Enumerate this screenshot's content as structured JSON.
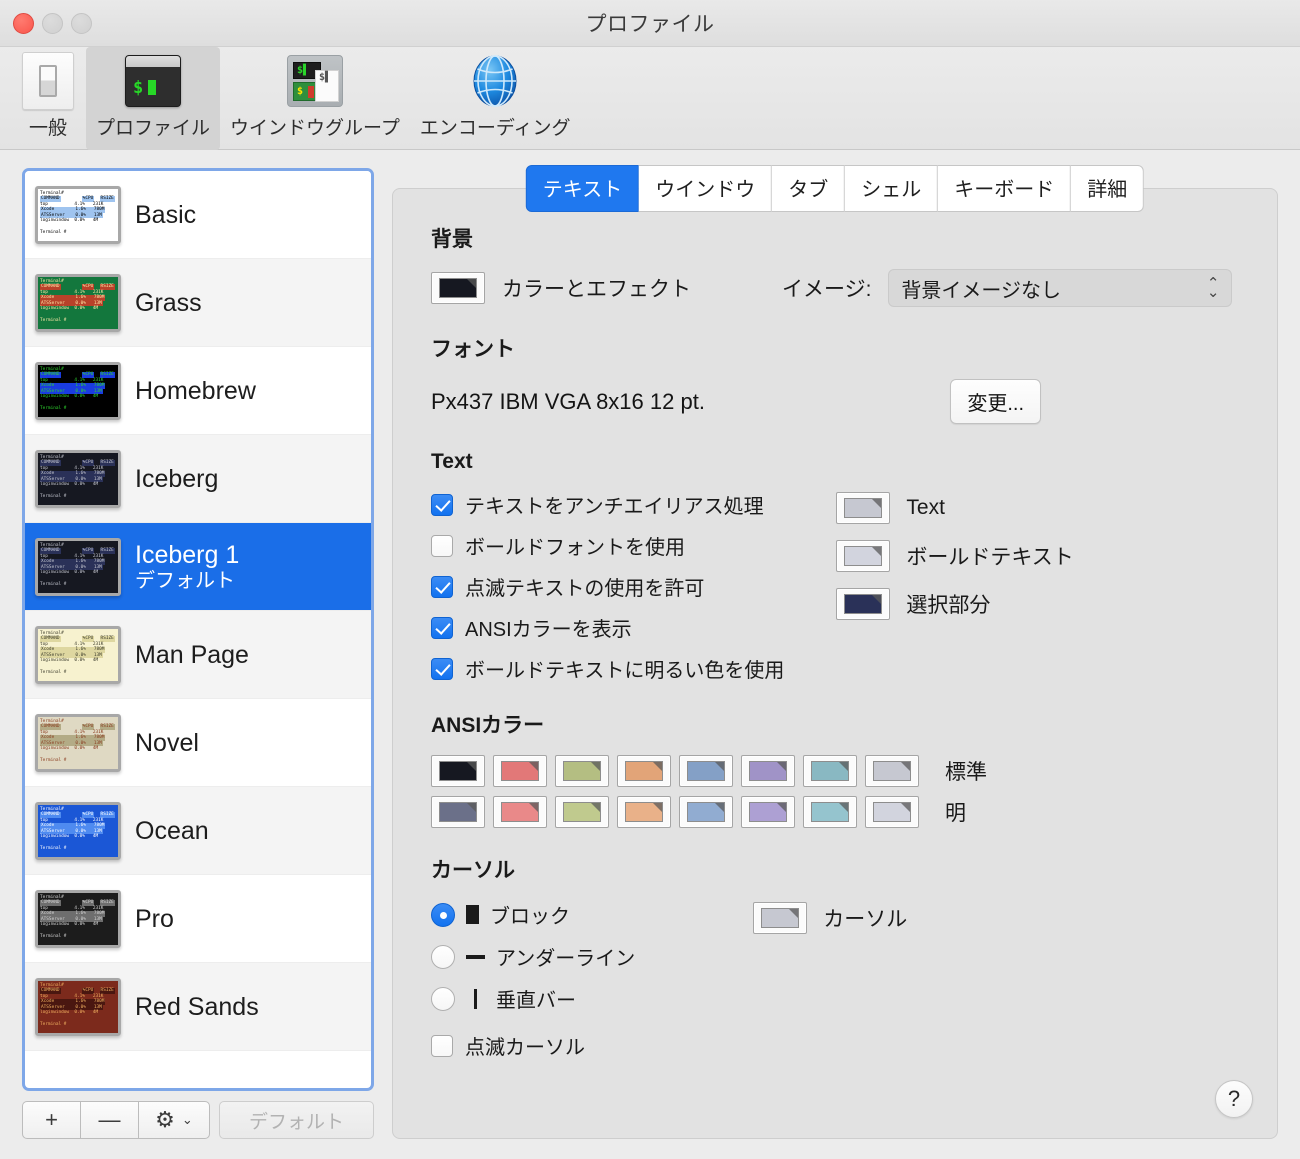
{
  "window": {
    "title": "プロファイル",
    "traffic_lights": [
      "close",
      "minimize",
      "maximize"
    ]
  },
  "toolbar": {
    "items": [
      {
        "label": "一般",
        "icon": "toggle-switch-icon",
        "active": false
      },
      {
        "label": "プロファイル",
        "icon": "terminal-icon",
        "active": true
      },
      {
        "label": "ウインドウグループ",
        "icon": "window-group-icon",
        "active": false
      },
      {
        "label": "エンコーディング",
        "icon": "globe-icon",
        "active": false
      }
    ]
  },
  "profile_list": {
    "items": [
      {
        "name": "Basic",
        "subtitle": "",
        "selected": false,
        "bg": "#ffffff",
        "fg": "#000000",
        "accent": "#9fc4ef"
      },
      {
        "name": "Grass",
        "subtitle": "",
        "selected": false,
        "bg": "#13773d",
        "fg": "#ffe9a8",
        "accent": "#b8422a"
      },
      {
        "name": "Homebrew",
        "subtitle": "",
        "selected": false,
        "bg": "#000000",
        "fg": "#2fd82f",
        "accent": "#1a3ce0"
      },
      {
        "name": "Iceberg",
        "subtitle": "",
        "selected": false,
        "bg": "#161821",
        "fg": "#c6c8d1",
        "accent": "#2a3158"
      },
      {
        "name": "Iceberg 1",
        "subtitle": "デフォルト",
        "selected": true,
        "bg": "#161821",
        "fg": "#c6c8d1",
        "accent": "#2a3158"
      },
      {
        "name": "Man Page",
        "subtitle": "",
        "selected": false,
        "bg": "#f7f2cf",
        "fg": "#3a3a2a",
        "accent": "#ded7a0"
      },
      {
        "name": "Novel",
        "subtitle": "",
        "selected": false,
        "bg": "#dfd9c3",
        "fg": "#8a3b1e",
        "accent": "#b3ab86"
      },
      {
        "name": "Ocean",
        "subtitle": "",
        "selected": false,
        "bg": "#1b57d6",
        "fg": "#ffffff",
        "accent": "#4f8bf0"
      },
      {
        "name": "Pro",
        "subtitle": "",
        "selected": false,
        "bg": "#1c1c1c",
        "fg": "#d4d4d4",
        "accent": "#6e6e6e"
      },
      {
        "name": "Red Sands",
        "subtitle": "",
        "selected": false,
        "bg": "#7c2a1c",
        "fg": "#f0b060",
        "accent": "#4a1710"
      }
    ],
    "thumbnail_text": {
      "line1": "Terminal#",
      "line2": "COMMAND",
      "cols": [
        "%CPU",
        "RSIZE"
      ],
      "rows": [
        {
          "name": "top",
          "cpu": "4.1%",
          "rsize": "231K"
        },
        {
          "name": "Xcode",
          "cpu": "1.6%",
          "rsize": "780M"
        },
        {
          "name": "ATSServer",
          "cpu": "0.0%",
          "rsize": "13M"
        },
        {
          "name": "loginwindow",
          "cpu": "0.0%",
          "rsize": "4M"
        }
      ],
      "prompt": "Terminal #"
    },
    "toolbar": {
      "add_label": "+",
      "remove_label": "—",
      "gear_label": "⚙",
      "gear_chevron": "⌄",
      "default_label": "デフォルト",
      "default_disabled": true
    }
  },
  "tabs": [
    {
      "label": "テキスト",
      "active": true
    },
    {
      "label": "ウインドウ",
      "active": false
    },
    {
      "label": "タブ",
      "active": false
    },
    {
      "label": "シェル",
      "active": false
    },
    {
      "label": "キーボード",
      "active": false
    },
    {
      "label": "詳細",
      "active": false
    }
  ],
  "background": {
    "title": "背景",
    "color_swatch_label": "カラーとエフェクト",
    "color_swatch_value": "#161821",
    "image_label": "イメージ:",
    "image_value": "背景イメージなし"
  },
  "font": {
    "title": "フォント",
    "value": "Px437 IBM VGA 8x16 12 pt.",
    "change_button": "変更..."
  },
  "text": {
    "title": "Text",
    "checkboxes": [
      {
        "label": "テキストをアンチエイリアス処理",
        "checked": true
      },
      {
        "label": "ボールドフォントを使用",
        "checked": false
      },
      {
        "label": "点滅テキストの使用を許可",
        "checked": true
      },
      {
        "label": "ANSIカラーを表示",
        "checked": true
      },
      {
        "label": "ボールドテキストに明るい色を使用",
        "checked": true
      }
    ],
    "colors": [
      {
        "label": "Text",
        "value": "#c6c8d1"
      },
      {
        "label": "ボールドテキスト",
        "value": "#d2d4de"
      },
      {
        "label": "選択部分",
        "value": "#2a3158"
      }
    ]
  },
  "ansi": {
    "title": "ANSIカラー",
    "rows": [
      {
        "label": "標準",
        "colors": [
          "#161821",
          "#e27878",
          "#b4be82",
          "#e2a478",
          "#84a0c6",
          "#a093c7",
          "#89b8c2",
          "#c6c8d1"
        ]
      },
      {
        "label": "明",
        "colors": [
          "#6b7089",
          "#e98989",
          "#c0ca8e",
          "#e9b189",
          "#91acd1",
          "#ada0d3",
          "#95c4ce",
          "#d2d4de"
        ]
      }
    ]
  },
  "cursor": {
    "title": "カーソル",
    "options": [
      {
        "label": "ブロック",
        "glyph": "block",
        "selected": true
      },
      {
        "label": "アンダーライン",
        "glyph": "underline",
        "selected": false
      },
      {
        "label": "垂直バー",
        "glyph": "vbar",
        "selected": false
      }
    ],
    "blink": {
      "label": "点滅カーソル",
      "checked": false
    },
    "color": {
      "label": "カーソル",
      "value": "#c6c8d1"
    }
  },
  "help": {
    "label": "?"
  }
}
